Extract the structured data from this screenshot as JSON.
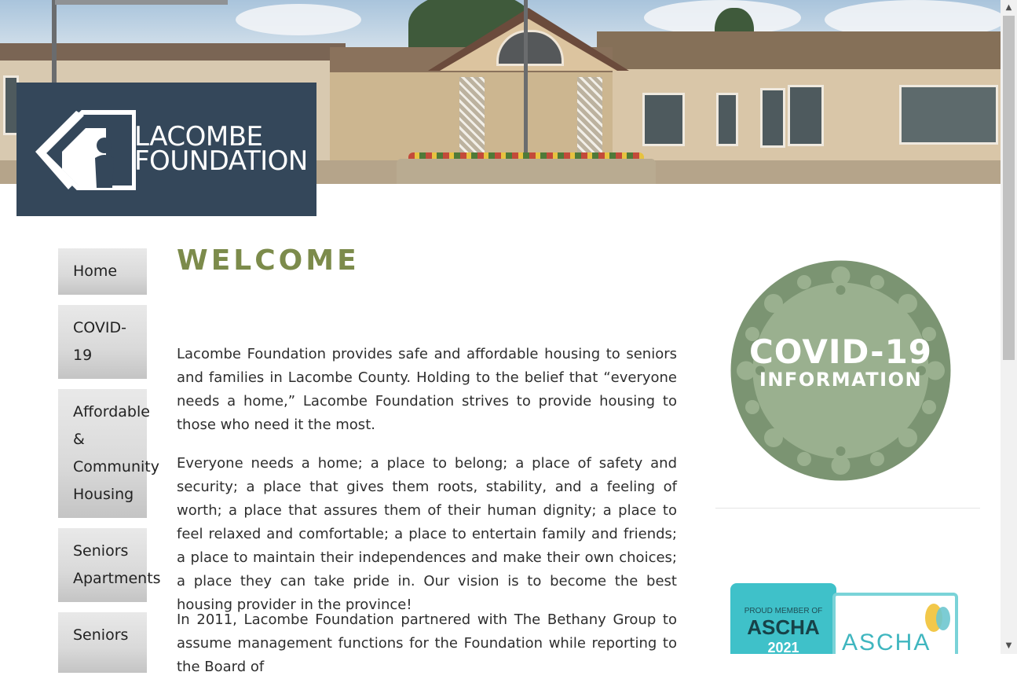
{
  "header": {
    "logo": {
      "line1": "LACOMBE",
      "line2": "FOUNDATION"
    }
  },
  "nav": {
    "items": [
      {
        "label": "Home",
        "lines": [
          "Home"
        ]
      },
      {
        "label": "COVID-19",
        "lines": [
          "COVID-",
          "19"
        ]
      },
      {
        "label": "Affordable & Community Housing",
        "lines": [
          "Affordable",
          "&",
          "Community",
          "Housing"
        ]
      },
      {
        "label": "Seniors Apartments",
        "lines": [
          "Seniors",
          "Apartments"
        ]
      },
      {
        "label": "Seniors",
        "lines": [
          "Seniors"
        ]
      }
    ]
  },
  "main": {
    "title": "WELCOME",
    "paragraphs": [
      "Lacombe Foundation provides safe and affordable housing to seniors and families in Lacombe County. Holding to the belief that “everyone needs a home,” Lacombe Foundation strives to provide housing to those who need it the most.",
      "Everyone needs a home; a place to belong; a place of safety and security; a place that gives them roots, stability, and a feeling of worth; a place that assures them of their human dignity; a place to feel relaxed and comfortable; a place to entertain family and friends; a place to maintain their independences and make their own choices; a place they can take pride in. Our vision is to become the best housing provider in the province!",
      "In 2011, Lacombe Foundation partnered with The Bethany Group to assume management functions for the Foundation while reporting to the Board of"
    ]
  },
  "sidebar": {
    "covid_badge": {
      "line1": "COVID-19",
      "line2": "INFORMATION",
      "color": "#7b9472",
      "inner_color": "#9ab08f"
    },
    "ascha_badge": {
      "proud": "PROUD MEMBER OF",
      "name": "ASCHA",
      "year": "2021",
      "brand": "ASCHA"
    }
  },
  "colors": {
    "logo_bg": "#34475a",
    "title": "#7c8b4b",
    "nav_gradient_top": "#e9e9e9",
    "nav_gradient_bottom": "#c4c4c4",
    "ascha_teal": "#3fc1c9"
  },
  "scrollbar": {
    "up_icon": "▲",
    "down_icon": "▼"
  }
}
